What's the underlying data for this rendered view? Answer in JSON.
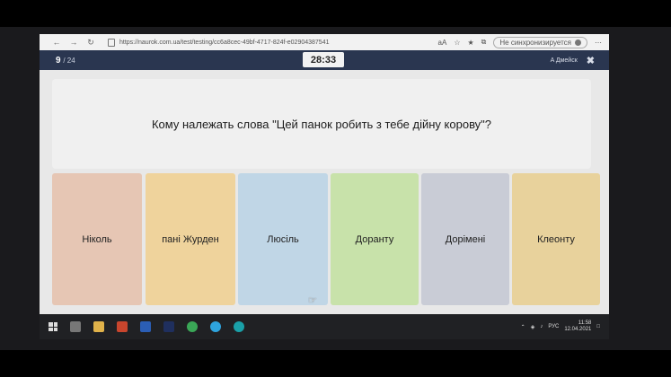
{
  "browser": {
    "url": "https://naurok.com.ua/test/testing/cc6a8cec-49bf-4717-824f-e02904387541",
    "profile_label": "Не синхронизируется"
  },
  "quiz": {
    "current": "9",
    "total": "/ 24",
    "timer": "28:33",
    "user": "A Дмейск",
    "question": "Кому належать слова \"Цей панок робить з тебе дійну корову\"?",
    "answers": [
      {
        "label": "Ніколь",
        "color": "#e6c6b4"
      },
      {
        "label": "пані Журден",
        "color": "#efd39c"
      },
      {
        "label": "Люсіль",
        "color": "#c0d6e6"
      },
      {
        "label": "Доранту",
        "color": "#c8e2aa"
      },
      {
        "label": "Дорімені",
        "color": "#c9ccd6"
      },
      {
        "label": "Клеонту",
        "color": "#e8d29c"
      }
    ]
  },
  "taskbar": {
    "lang": "РУС",
    "time": "11:58",
    "date": "12.04.2021"
  }
}
